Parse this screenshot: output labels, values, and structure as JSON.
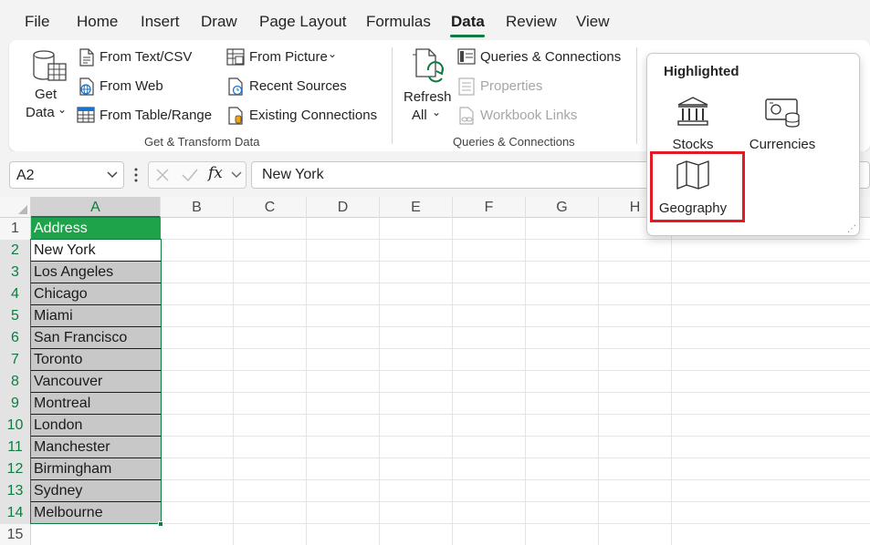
{
  "menu": {
    "tabs": [
      "File",
      "Home",
      "Insert",
      "Draw",
      "Page Layout",
      "Formulas",
      "Data",
      "Review",
      "View"
    ],
    "active_tab": "Data"
  },
  "ribbon": {
    "get_transform": {
      "get_data_line1": "Get",
      "get_data_line2": "Data",
      "from_text_csv": "From Text/CSV",
      "from_web": "From Web",
      "from_table_range": "From Table/Range",
      "from_picture": "From Picture",
      "recent_sources": "Recent Sources",
      "existing_connections": "Existing Connections",
      "group_label": "Get & Transform Data"
    },
    "queries": {
      "refresh_line1": "Refresh",
      "refresh_line2": "All",
      "queries_connections": "Queries & Connections",
      "properties": "Properties",
      "workbook_links": "Workbook Links",
      "group_label": "Queries & Connections"
    }
  },
  "formula_bar": {
    "name_box": "A2",
    "fx_label": "fx",
    "formula": "New York"
  },
  "grid": {
    "columns": [
      "A",
      "B",
      "C",
      "D",
      "E",
      "F",
      "G",
      "H"
    ],
    "row_numbers": [
      "1",
      "2",
      "3",
      "4",
      "5",
      "6",
      "7",
      "8",
      "9",
      "10",
      "11",
      "12",
      "13",
      "14",
      "15"
    ],
    "cells": [
      "Address",
      "New York",
      "Los Angeles",
      "Chicago",
      "Miami",
      "San Francisco",
      "Toronto",
      "Vancouver",
      "Montreal",
      "London",
      "Manchester",
      "Birmingham",
      "Sydney",
      "Melbourne"
    ]
  },
  "popup": {
    "title": "Highlighted",
    "stocks": "Stocks",
    "currencies": "Currencies",
    "geography": "Geography"
  },
  "colors": {
    "accent": "#107c41",
    "header_fill": "#1fa34a",
    "highlight_box": "#e01b24"
  }
}
